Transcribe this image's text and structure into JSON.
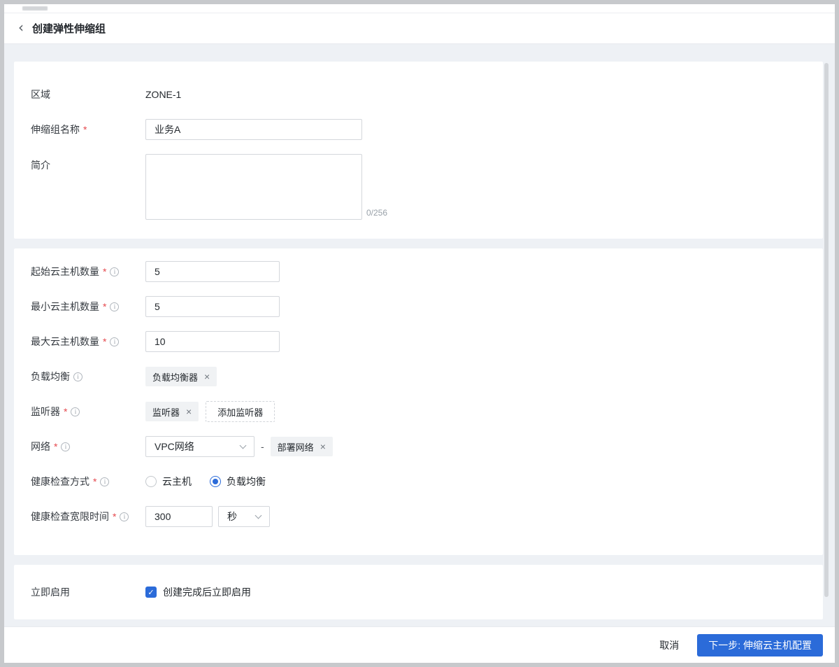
{
  "colors": {
    "accent": "#2b6bd9",
    "required": "#e5484d",
    "content_bg": "#eef1f5"
  },
  "marks": {
    "required": "*",
    "info": "i",
    "close": "×",
    "check": "✓",
    "back": "‹"
  },
  "page_header": {
    "title": "创建弹性伸缩组"
  },
  "basic": {
    "zone": {
      "label": "区域",
      "value": "ZONE-1"
    },
    "name": {
      "label": "伸缩组名称",
      "required": true,
      "value": "业务A",
      "placeholder": ""
    },
    "intro": {
      "label": "简介",
      "value": "",
      "placeholder": "",
      "counter": "0/256"
    }
  },
  "config": {
    "initial": {
      "label": "起始云主机数量",
      "required": true,
      "value": "5"
    },
    "min": {
      "label": "最小云主机数量",
      "required": true,
      "value": "5"
    },
    "max": {
      "label": "最大云主机数量",
      "required": true,
      "value": "10"
    },
    "lb": {
      "label": "负载均衡",
      "tag": "负载均衡器"
    },
    "listener": {
      "label": "监听器",
      "required": true,
      "tag": "监听器",
      "add_button": "添加监听器"
    },
    "network": {
      "label": "网络",
      "required": true,
      "select_value": "VPC网络",
      "separator": "-",
      "tag": "部署网络"
    },
    "health_mode": {
      "label": "健康检查方式",
      "required": true,
      "options": [
        {
          "label": "云主机",
          "checked": false
        },
        {
          "label": "负载均衡",
          "checked": true
        }
      ]
    },
    "grace": {
      "label": "健康检查宽限时间",
      "required": true,
      "value": "300",
      "unit": "秒"
    }
  },
  "enable": {
    "label": "立即启用",
    "checkbox_label": "创建完成后立即启用",
    "checked": true
  },
  "footer": {
    "cancel": "取消",
    "next": "下一步: 伸缩云主机配置"
  }
}
